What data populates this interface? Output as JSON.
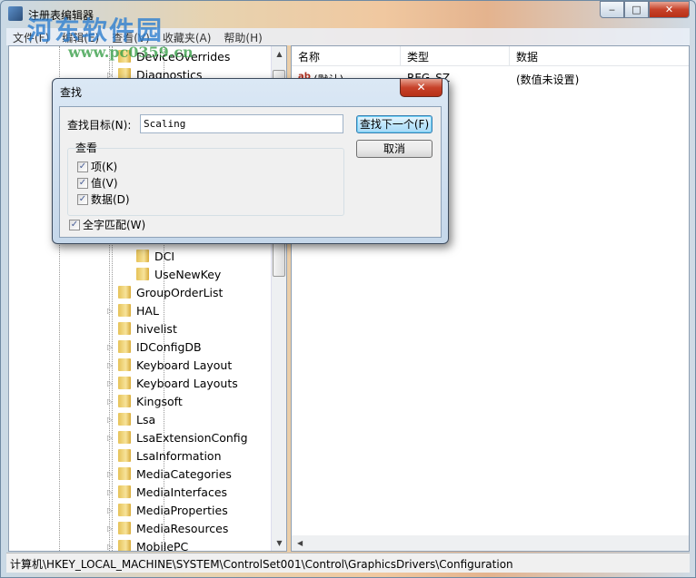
{
  "window": {
    "title": "注册表编辑器",
    "minimize": "‒",
    "maximize": "□",
    "close": "✕"
  },
  "watermark": {
    "name": "河东软件园",
    "url": "www.pc0359.cn"
  },
  "menu": [
    "文件(F)",
    "编辑(E)",
    "查看(V)",
    "收藏夹(A)",
    "帮助(H)"
  ],
  "tree": {
    "top_items": [
      {
        "label": "DeviceOverrides",
        "expand": false
      },
      {
        "label": "Diagnostics",
        "expand": true
      }
    ],
    "sub_items": [
      {
        "label": "DCI"
      },
      {
        "label": "UseNewKey"
      }
    ],
    "items": [
      {
        "label": "GroupOrderList",
        "expand": false
      },
      {
        "label": "HAL",
        "expand": true
      },
      {
        "label": "hivelist",
        "expand": false
      },
      {
        "label": "IDConfigDB",
        "expand": true
      },
      {
        "label": "Keyboard Layout",
        "expand": true
      },
      {
        "label": "Keyboard Layouts",
        "expand": true
      },
      {
        "label": "Kingsoft",
        "expand": true
      },
      {
        "label": "Lsa",
        "expand": true
      },
      {
        "label": "LsaExtensionConfig",
        "expand": true
      },
      {
        "label": "LsaInformation",
        "expand": false
      },
      {
        "label": "MediaCategories",
        "expand": true
      },
      {
        "label": "MediaInterfaces",
        "expand": true
      },
      {
        "label": "MediaProperties",
        "expand": true
      },
      {
        "label": "MediaResources",
        "expand": true
      },
      {
        "label": "MobilePC",
        "expand": true
      }
    ]
  },
  "list": {
    "columns": [
      "名称",
      "类型",
      "数据"
    ],
    "rows": [
      {
        "name": "(默认)",
        "type": "REG_SZ",
        "data": "(数值未设置)"
      }
    ]
  },
  "status": "计算机\\HKEY_LOCAL_MACHINE\\SYSTEM\\ControlSet001\\Control\\GraphicsDrivers\\Configuration",
  "dialog": {
    "title": "查找",
    "close": "✕",
    "find_label": "查找目标(N):",
    "find_value": "Scaling",
    "find_next": "查找下一个(F)",
    "cancel": "取消",
    "look_at": "查看",
    "options": [
      {
        "label": "项(K)",
        "checked": true
      },
      {
        "label": "值(V)",
        "checked": true
      },
      {
        "label": "数据(D)",
        "checked": true
      }
    ],
    "match_whole": {
      "label": "全字匹配(W)",
      "checked": true
    }
  }
}
